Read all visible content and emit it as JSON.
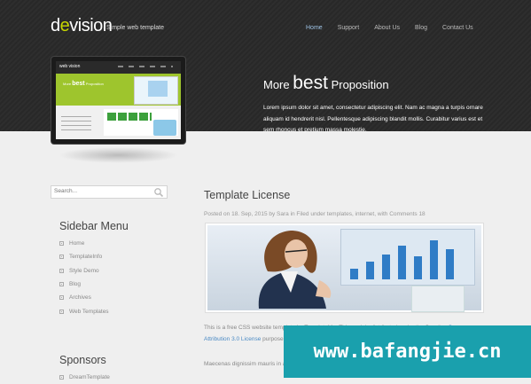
{
  "header": {
    "logo": "devision",
    "tagline": "Simple web template",
    "nav": [
      {
        "label": "Home",
        "active": true
      },
      {
        "label": "Support",
        "active": false
      },
      {
        "label": "About Us",
        "active": false
      },
      {
        "label": "Blog",
        "active": false
      },
      {
        "label": "Contact Us",
        "active": false
      }
    ]
  },
  "promo": {
    "title_pre": "More",
    "title_big": "best",
    "title_post": "Proposition",
    "text": "Lorem ipsum dolor sit amet, consectetur adipiscing elit. Nam ac magna a turpis ornare aliquam id hendrerit nisl. Pellentesque adipiscing blandit mollis. Curabitur varius est et sem rhoncus et pretium massa molestie."
  },
  "monitor_screen": {
    "logo": "web vision",
    "banner_pre": "More",
    "banner_big": "best",
    "banner_post": "Proposition"
  },
  "search": {
    "placeholder": "Search..."
  },
  "sidebar": {
    "menu_title": "Sidebar Menu",
    "menu_items": [
      "Home",
      "TemplateInfo",
      "Style Demo",
      "Blog",
      "Archives",
      "Web Templates"
    ],
    "sponsors_title": "Sponsors",
    "sponsor_items": [
      "DreamTemplate"
    ]
  },
  "post": {
    "title": "Template License",
    "meta": "Posted on 18. Sep, 2015 by Sara in Filed under templates, internet, with Comments 18",
    "para1_a": "This is a free CSS website template by TemplateMo. This work is distributed under the Creative",
    "para1_link": "Commons Attribution 3.0 License",
    "para1_b": "purpose provided you credit me...",
    "para2": "Maecenas dignissim mauris in arcu congue tincidunt. Vivamus elit nunc, scelerisque a quam. Aenean at mauris..."
  },
  "watermark": "www.bafangjie.cn",
  "colors": {
    "accent_nav": "#9fc4e6",
    "link": "#4a8ac4",
    "watermark_bg": "#1aa0ad"
  }
}
